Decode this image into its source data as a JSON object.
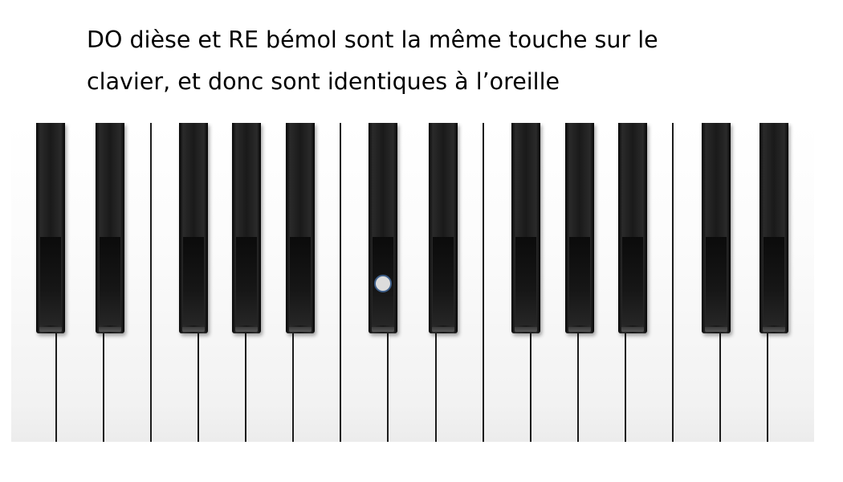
{
  "caption": {
    "line1": "DO dièse et RE bémol sont la même touche sur le",
    "line2": "clavier, et donc sont identiques à l’oreille"
  },
  "colors": {
    "text": "#000000",
    "black_key": "#111111",
    "white_key": "#ffffff",
    "marker_fill": "#dcdcdc",
    "marker_border": "#3e5f8a"
  }
}
